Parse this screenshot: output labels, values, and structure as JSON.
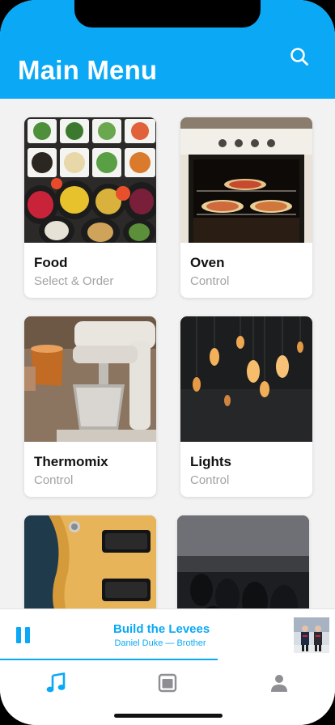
{
  "header": {
    "title": "Main Menu"
  },
  "cards": [
    {
      "title": "Food",
      "subtitle": "Select & Order"
    },
    {
      "title": "Oven",
      "subtitle": "Control"
    },
    {
      "title": "Thermomix",
      "subtitle": "Control"
    },
    {
      "title": "Lights",
      "subtitle": "Control"
    }
  ],
  "player": {
    "song": "Build the Levees",
    "artist": "Daniel Duke — Brother",
    "progress": 0.65
  },
  "tabs": [
    {
      "icon": "music-note-icon",
      "active": true
    },
    {
      "icon": "tablet-icon",
      "active": false
    },
    {
      "icon": "profile-icon",
      "active": false
    }
  ],
  "colors": {
    "accent": "#0aa8f5",
    "inactive": "#8e8e93"
  }
}
